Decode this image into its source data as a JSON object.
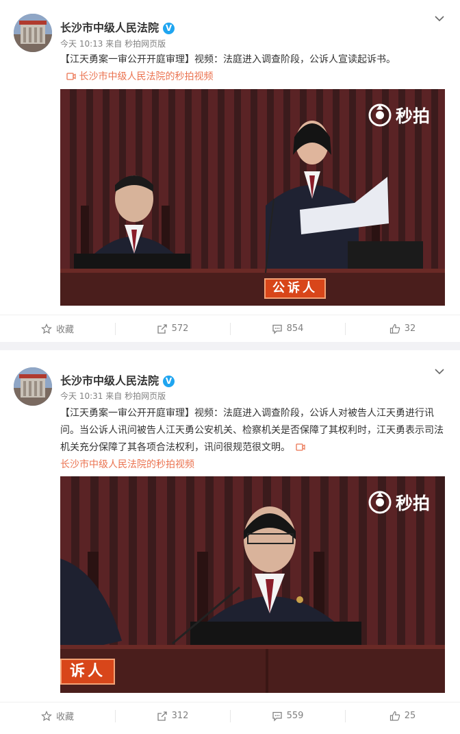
{
  "posts": [
    {
      "author": "长沙市中级人民法院",
      "verified_badge": "V",
      "time": "今天 10:13",
      "source_prefix": "来自",
      "source": "秒拍网页版",
      "text": "【江天勇案一审公开开庭审理】视频：法庭进入调查阶段，公诉人宣读起诉书。",
      "video_link": "长沙市中级人民法院的秒拍视频",
      "watermark": "秒拍",
      "sign_text": "公诉人",
      "actions": {
        "favorite": "收藏",
        "repost": "572",
        "comment": "854",
        "like": "32"
      }
    },
    {
      "author": "长沙市中级人民法院",
      "verified_badge": "V",
      "time": "今天 10:31",
      "source_prefix": "来自",
      "source": "秒拍网页版",
      "text": "【江天勇案一审公开开庭审理】视频：法庭进入调查阶段，公诉人对被告人江天勇进行讯问。当公诉人讯问被告人江天勇公安机关、检察机关是否保障了其权利时，江天勇表示司法机关充分保障了其各项合法权利，讯问很规范很文明。",
      "video_link": "长沙市中级人民法院的秒拍视频",
      "watermark": "秒拍",
      "sign_text": "诉人",
      "actions": {
        "favorite": "收藏",
        "repost": "312",
        "comment": "559",
        "like": "25"
      }
    }
  ],
  "colors": {
    "link": "#eb7350",
    "verified": "#1fa5f0",
    "meta": "#808080"
  }
}
